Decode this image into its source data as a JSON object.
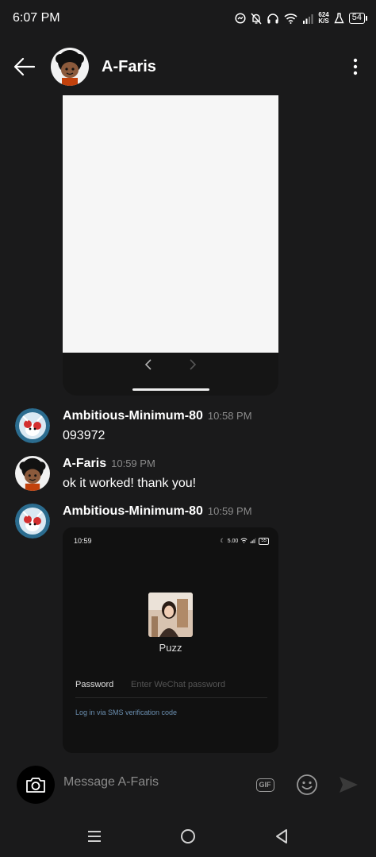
{
  "status_bar": {
    "time": "6:07 PM",
    "net_speed_value": "624",
    "net_speed_unit": "K/S",
    "battery": "54"
  },
  "header": {
    "title": "A-Faris"
  },
  "messages": [
    {
      "author": "Ambitious-Minimum-80",
      "time": "10:58 PM",
      "text": "093972"
    },
    {
      "author": "A-Faris",
      "time": "10:59 PM",
      "text": "ok it worked! thank you!"
    },
    {
      "author": "Ambitious-Minimum-80",
      "time": "10:59 PM"
    }
  ],
  "shared_screenshot": {
    "time": "10:59",
    "net_speed": "5.00",
    "battery": "55",
    "username": "Puzz",
    "password_label": "Password",
    "password_placeholder": "Enter WeChat password",
    "sms_link": "Log in via SMS verification code"
  },
  "composer": {
    "placeholder": "Message A-Faris",
    "gif_label": "GIF"
  }
}
